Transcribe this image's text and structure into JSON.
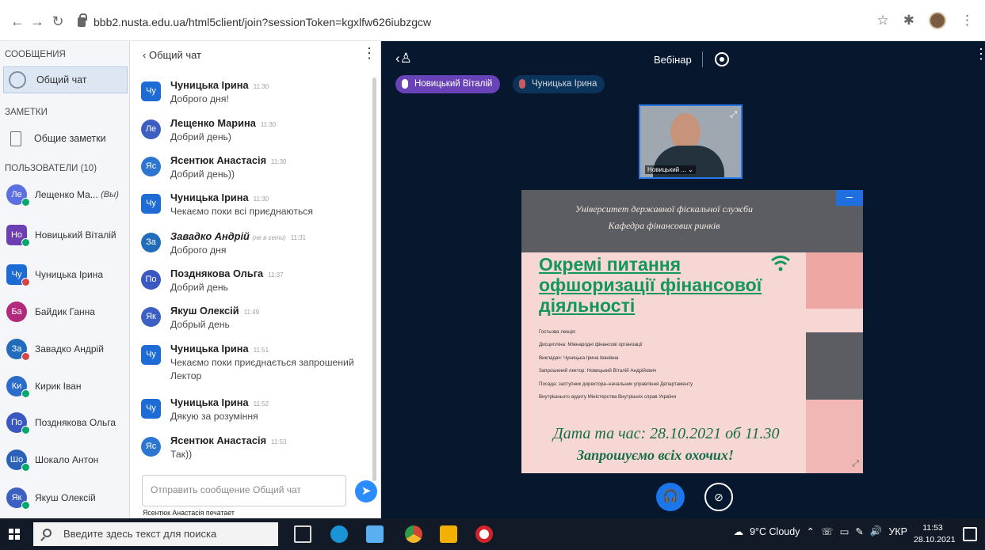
{
  "browser": {
    "url": "bbb2.nusta.edu.ua/html5client/join?sessionToken=kgxlfw626iubzgcw"
  },
  "sidebar": {
    "messages_title": "СООБЩЕНИЯ",
    "public_chat_label": "Общий чат",
    "notes_title": "ЗАМЕТКИ",
    "shared_notes_label": "Общие заметки",
    "users_title": "ПОЛЬЗОВАТЕЛИ (10)",
    "users": [
      {
        "initials": "Ле",
        "name": "Лещенко Ма...",
        "suffix": "(Вы)",
        "color": "#5b6fe0",
        "status": "green"
      },
      {
        "initials": "Но",
        "name": "Новицький Віталій",
        "suffix": "",
        "color": "#6c3fb2",
        "status": "green"
      },
      {
        "initials": "Чу",
        "name": "Чуницька Ірина",
        "suffix": "",
        "color": "#1d6bd4",
        "status": "red"
      },
      {
        "initials": "Ба",
        "name": "Байдик Ганна",
        "suffix": "",
        "color": "#b12a7b",
        "status": ""
      },
      {
        "initials": "За",
        "name": "Завадко Андрій",
        "suffix": "",
        "color": "#226cbc",
        "status": "red"
      },
      {
        "initials": "Ки",
        "name": "Кирик Іван",
        "suffix": "",
        "color": "#2c6cc9",
        "status": "green"
      },
      {
        "initials": "По",
        "name": "Позднякова Ольга",
        "suffix": "",
        "color": "#3a57c2",
        "status": "green"
      },
      {
        "initials": "Шо",
        "name": "Шокало Антон",
        "suffix": "",
        "color": "#2b62b8",
        "status": "green"
      },
      {
        "initials": "Як",
        "name": "Якуш Олексій",
        "suffix": "",
        "color": "#3b5fc3",
        "status": "green"
      }
    ]
  },
  "chat": {
    "back_label": "Общий чат",
    "messages": [
      {
        "initials": "Чу",
        "name": "Чуницька Ірина",
        "time": "11:30",
        "offline": "",
        "text": "Доброго дня!",
        "color": "#1d6bd4",
        "square": true
      },
      {
        "initials": "Ле",
        "name": "Лещенко Марина",
        "time": "11:30",
        "offline": "",
        "text": "Добрий день)",
        "color": "#3c5ec1",
        "square": false
      },
      {
        "initials": "Яс",
        "name": "Ясентюк Анастасія",
        "time": "11:30",
        "offline": "",
        "text": "Добрий день))",
        "color": "#2c76d2",
        "square": false
      },
      {
        "initials": "Чу",
        "name": "Чуницька Ірина",
        "time": "11:30",
        "offline": "",
        "text": "Чекаємо поки всі приєднаються",
        "color": "#1d6bd4",
        "square": true
      },
      {
        "initials": "За",
        "name": "Завадко Андрій",
        "time": "11:31",
        "offline": "(не в сети)",
        "text": "Доброго дня",
        "color": "#226cbc",
        "square": false
      },
      {
        "initials": "По",
        "name": "Позднякова Ольга",
        "time": "11:37",
        "offline": "",
        "text": "Добрий день",
        "color": "#3a57c2",
        "square": false
      },
      {
        "initials": "Як",
        "name": "Якуш Олексій",
        "time": "11:49",
        "offline": "",
        "text": "Добрый день",
        "color": "#3b5fc3",
        "square": false
      },
      {
        "initials": "Чу",
        "name": "Чуницька Ірина",
        "time": "11:51",
        "offline": "",
        "text": "Чекаємо поки приєднається запрошений Лектор",
        "color": "#1d6bd4",
        "square": true
      },
      {
        "initials": "Чу",
        "name": "Чуницька Ірина",
        "time": "11:52",
        "offline": "",
        "text": "Дякую за розуміння",
        "color": "#1d6bd4",
        "square": true
      },
      {
        "initials": "Яс",
        "name": "Ясентюк Анастасія",
        "time": "11:53",
        "offline": "",
        "text": "Так))",
        "color": "#2c76d2",
        "square": false
      }
    ],
    "input_placeholder": "Отправить сообщение Общий чат",
    "typing_text": "Ясентюк Анастасія печатает"
  },
  "stage": {
    "title": "Вебінар",
    "talkers": [
      {
        "name": "Новицький Віталій",
        "color": "#6942b8"
      },
      {
        "name": "Чуницька Ірина",
        "color": "#0b3b67"
      }
    ],
    "webcam_label": "Новицький ... ⌄",
    "slide": {
      "header_line_1": "Університет державної фіскальної служби",
      "header_line_2": "Кафедра фінансових ринків",
      "title": "Окремі питання офшоризації фінансової діяльності",
      "line_1": "Гостьова лекція:",
      "line_2": "Дисципліна: Міжнародні фінансові організації",
      "line_3": "Викладач: Чуницька Ірина Іванівна",
      "line_4": "Запрошений лектор: Новицький Віталій Андрійович",
      "line_5": "Посада: заступник директора–начальник управління Департаменту",
      "line_6": "Внутрішнього аудиту Міністерства Внутрішніх справ України",
      "date": "Дата та час: 28.10.2021 об 11.30",
      "invite": "Запрошуємо всіх охочих!"
    }
  },
  "taskbar": {
    "search_placeholder": "Введите здесь текст для поиска",
    "weather": "9°C Cloudy",
    "language": "УКР",
    "time": "11:53",
    "date": "28.10.2021"
  }
}
